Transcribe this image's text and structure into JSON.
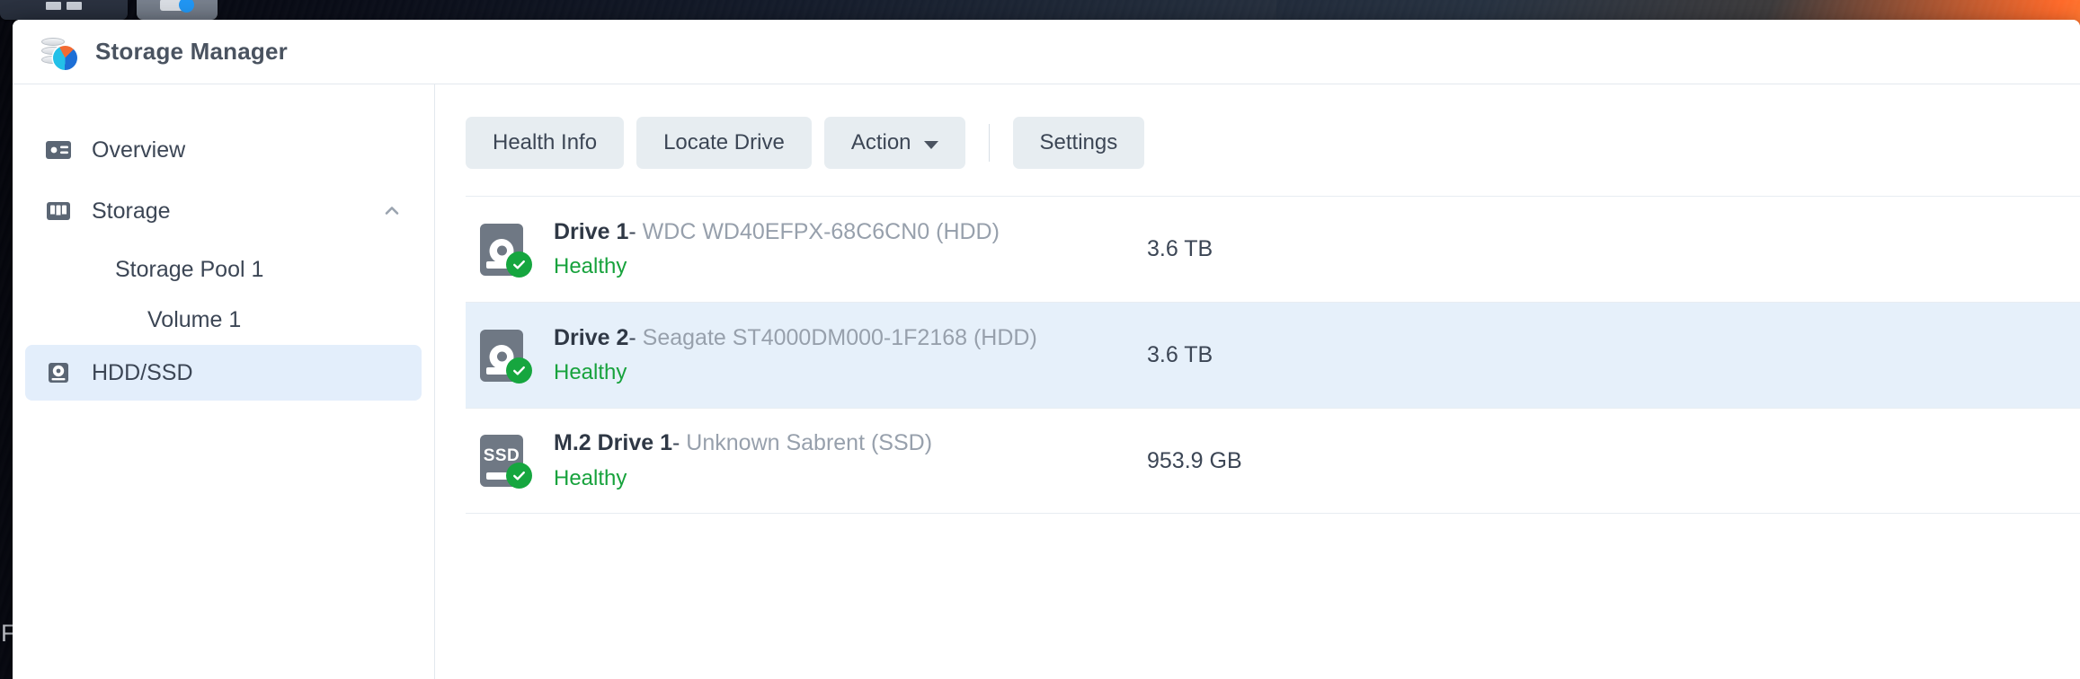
{
  "window": {
    "app_title": "Storage Manager",
    "app_icon": "storage-manager-icon"
  },
  "taskbar": {
    "tiles": [
      {
        "icon": "window-tile-icon"
      },
      {
        "icon": "storage-manager-tile-icon"
      }
    ]
  },
  "desktop": {
    "edge_letter": "F"
  },
  "sidebar": {
    "items": [
      {
        "label": "Overview",
        "icon": "overview-card-icon",
        "selected": false,
        "type": "nav"
      },
      {
        "label": "Storage",
        "icon": "storage-columns-icon",
        "selected": false,
        "type": "nav",
        "chevron": "chevron-up-icon",
        "expanded": true
      },
      {
        "label": "Storage Pool 1",
        "selected": false,
        "type": "sub"
      },
      {
        "label": "Volume 1",
        "selected": false,
        "type": "sub-deep"
      },
      {
        "label": "HDD/SSD",
        "icon": "hdd-disk-icon",
        "selected": true,
        "type": "nav"
      }
    ]
  },
  "toolbar": {
    "health_info_label": "Health Info",
    "locate_drive_label": "Locate Drive",
    "action_label": "Action",
    "action_caret": "caret-down-icon",
    "settings_label": "Settings"
  },
  "drives": [
    {
      "name": "Drive 1",
      "separator": "-",
      "model": "WDC WD40EFPX-68C6CN0 (HDD)",
      "status": "Healthy",
      "capacity": "3.6 TB",
      "type": "HDD",
      "icon": "hdd-drive-icon",
      "badge": "healthy-check-icon",
      "highlighted": false
    },
    {
      "name": "Drive 2",
      "separator": "-",
      "model": "Seagate ST4000DM000-1F2168 (HDD)",
      "status": "Healthy",
      "capacity": "3.6 TB",
      "type": "HDD",
      "icon": "hdd-drive-icon",
      "badge": "healthy-check-icon",
      "highlighted": true
    },
    {
      "name": "M.2 Drive 1",
      "separator": "-",
      "model": "Unknown Sabrent (SSD)",
      "status": "Healthy",
      "capacity": "953.9 GB",
      "type": "SSD",
      "icon": "ssd-drive-icon",
      "badge": "healthy-check-icon",
      "highlighted": false
    }
  ],
  "colors": {
    "accent": "#2196f3",
    "selected_row": "#e6f0fa",
    "selected_nav": "#e3eefb",
    "healthy_green": "#17a23c",
    "badge_green": "#16a63f",
    "button_bg": "#e7edf1",
    "text": "#3c4655",
    "muted_text": "#97a0ac"
  }
}
